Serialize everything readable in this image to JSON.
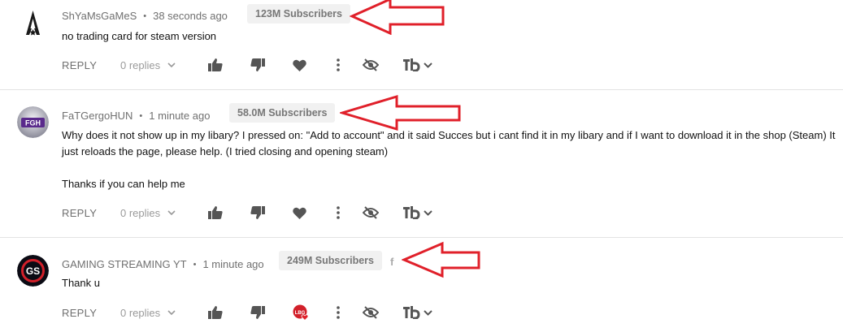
{
  "colors": {
    "arrow": "#e0202a",
    "badge_bg": "#f1f1f1",
    "text_muted": "#707070",
    "icon": "#555555"
  },
  "action_labels": {
    "reply": "REPLY",
    "replies": "0 replies"
  },
  "comments": [
    {
      "author": "ShYaMsGaMeS",
      "time": "38 seconds ago",
      "subscribers": "123M Subscribers",
      "avatar_icon": "assassin-creed-logo",
      "paragraphs": [
        "no trading card for steam version"
      ]
    },
    {
      "author": "FaTGergoHUN",
      "time": "1 minute ago",
      "subscribers": "58.0M Subscribers",
      "avatar_icon": "fgh-logo",
      "paragraphs": [
        "Why does it not show up in my libary? I pressed on: \"Add to account\" and it said Succes but i cant find it in my libary and if I want to download it in the shop (Steam) It just reloads the page, please help. (I tried closing and opening steam)",
        "Thanks if you can help me"
      ]
    },
    {
      "author": "GAMING STREAMING YT",
      "time": "1 minute ago",
      "subscribers": "249M Subscribers",
      "avatar_icon": "gs-logo",
      "facebook_icon": "f",
      "paragraphs": [
        "Thank u"
      ]
    }
  ]
}
